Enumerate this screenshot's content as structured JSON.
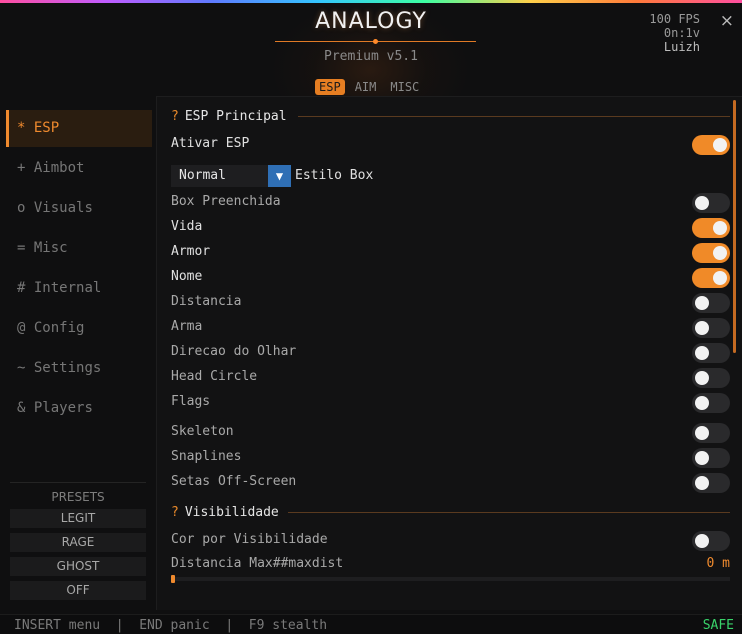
{
  "header": {
    "title": "ANALOGY",
    "subtitle": "Premium v5.1",
    "tabs": [
      "ESP",
      "AIM",
      "MISC"
    ],
    "active_tab": "ESP",
    "stats": {
      "fps": "100 FPS",
      "time": "0n:1v",
      "user": "Luizh"
    },
    "close_label": "×"
  },
  "sidebar": {
    "items": [
      {
        "icon": "*",
        "label": "ESP"
      },
      {
        "icon": "+",
        "label": "Aimbot"
      },
      {
        "icon": "o",
        "label": "Visuals"
      },
      {
        "icon": "=",
        "label": "Misc"
      },
      {
        "icon": "#",
        "label": "Internal"
      },
      {
        "icon": "@",
        "label": "Config"
      },
      {
        "icon": "~",
        "label": "Settings"
      },
      {
        "icon": "&",
        "label": "Players"
      }
    ],
    "active": "ESP",
    "presets_label": "PRESETS",
    "presets": [
      "LEGIT",
      "RAGE",
      "GHOST",
      "OFF"
    ]
  },
  "content": {
    "section1": {
      "marker": "?",
      "title": "ESP Principal"
    },
    "ativar_esp": {
      "label": "Ativar ESP",
      "on": true
    },
    "estilo_box": {
      "value": "Normal",
      "arrow": "▼",
      "label": "Estilo Box"
    },
    "toggles": [
      {
        "label": "Box Preenchida",
        "on": false
      },
      {
        "label": "Vida",
        "on": true
      },
      {
        "label": "Armor",
        "on": true
      },
      {
        "label": "Nome",
        "on": true
      },
      {
        "label": "Distancia",
        "on": false
      },
      {
        "label": "Arma",
        "on": false
      },
      {
        "label": "Direcao do Olhar",
        "on": false
      },
      {
        "label": "Head Circle",
        "on": false
      },
      {
        "label": "Flags",
        "on": false
      },
      {
        "label": "Skeleton",
        "on": false
      },
      {
        "label": "Snaplines",
        "on": false
      },
      {
        "label": "Setas Off-Screen",
        "on": false
      }
    ],
    "section2": {
      "marker": "?",
      "title": "Visibilidade"
    },
    "cor_visibilidade": {
      "label": "Cor por Visibilidade",
      "on": false
    },
    "distancia_max": {
      "label": "Distancia Max##maxdist",
      "value": "0 m",
      "fraction": 0
    }
  },
  "footer": {
    "hints": "INSERT menu  |  END panic  |  F9 stealth",
    "status": "SAFE"
  },
  "colors": {
    "accent": "#f08a28",
    "safe": "#39d36a",
    "dropdown_arrow": "#2f6fb5"
  }
}
